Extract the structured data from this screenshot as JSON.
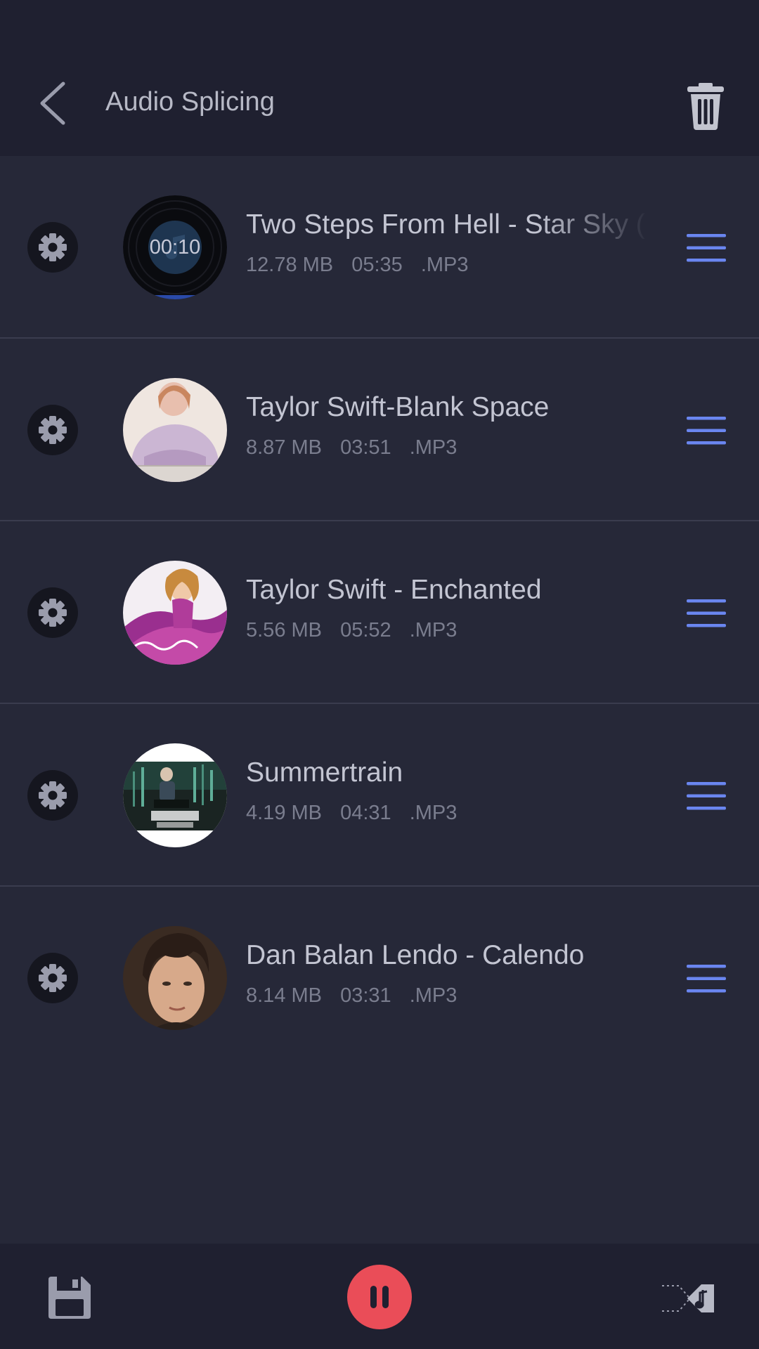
{
  "header": {
    "title": "Audio Splicing",
    "back_icon": "back-chevron-icon",
    "trash_icon": "trash-icon"
  },
  "tracks": [
    {
      "title": "Two Steps From Hell - Star Sky (",
      "size": "12.78 MB",
      "duration": "05:35",
      "format": ".MP3",
      "art_overlay": "00:10"
    },
    {
      "title": "Taylor Swift-Blank Space",
      "size": "8.87 MB",
      "duration": "03:51",
      "format": ".MP3"
    },
    {
      "title": "Taylor Swift - Enchanted",
      "size": "5.56 MB",
      "duration": "05:52",
      "format": ".MP3"
    },
    {
      "title": "Summertrain",
      "size": "4.19 MB",
      "duration": "04:31",
      "format": ".MP3"
    },
    {
      "title": "Dan Balan Lendo - Calendo",
      "size": "8.14 MB",
      "duration": "03:31",
      "format": ".MP3"
    }
  ],
  "bottom_bar": {
    "save_icon": "floppy-disk-icon",
    "pause_icon": "pause-icon",
    "merge_icon": "merge-audio-icon"
  },
  "colors": {
    "background": "#262838",
    "header": "#1f2030",
    "accent_blue": "#6a86f0",
    "pause_red": "#ea4d58"
  }
}
